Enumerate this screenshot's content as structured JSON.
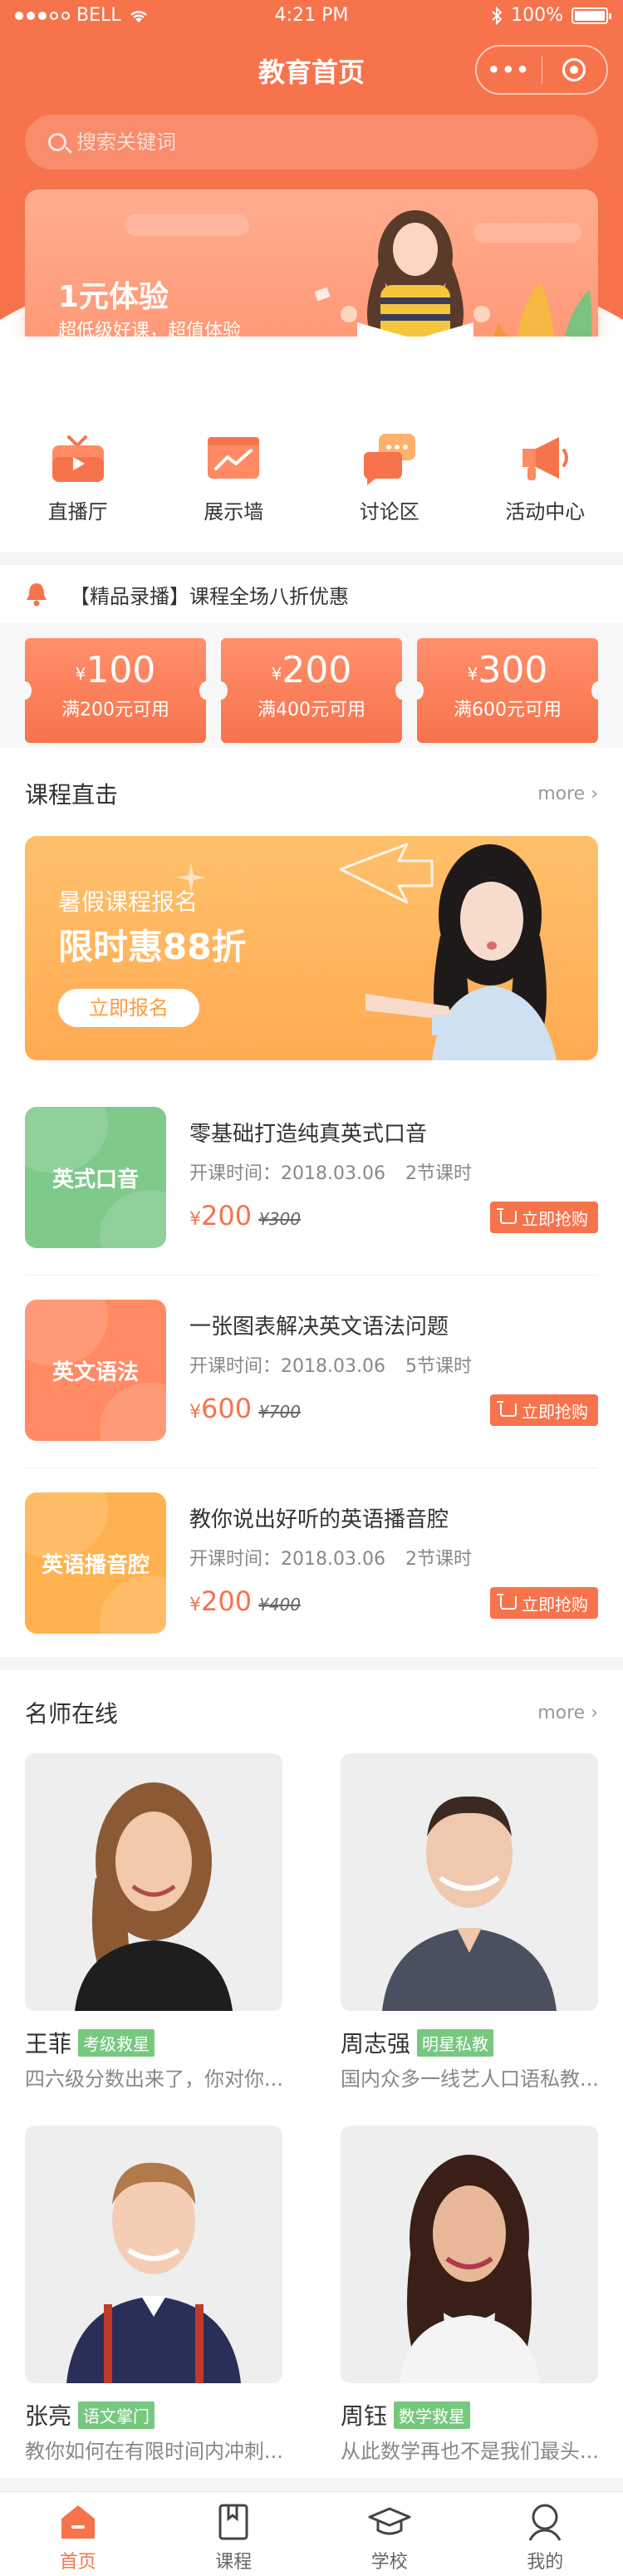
{
  "statusbar": {
    "carrier": "BELL",
    "time": "4:21 PM",
    "battery": "100%"
  },
  "navbar": {
    "title": "教育首页",
    "more_glyph": "•••"
  },
  "search": {
    "placeholder": "搜索关键词"
  },
  "banner": {
    "title": "1元体验",
    "subtitle": "超低级好课，超值体验"
  },
  "categories": [
    {
      "label": "直播厅",
      "icon": "tv-icon"
    },
    {
      "label": "展示墙",
      "icon": "chart-board-icon"
    },
    {
      "label": "讨论区",
      "icon": "chat-icon"
    },
    {
      "label": "活动中心",
      "icon": "megaphone-icon"
    }
  ],
  "notice": {
    "text": "【精品录播】课程全场八折优惠"
  },
  "coupons": [
    {
      "currency": "¥",
      "amount": "100",
      "condition": "满200元可用"
    },
    {
      "currency": "¥",
      "amount": "200",
      "condition": "满400元可用"
    },
    {
      "currency": "¥",
      "amount": "300",
      "condition": "满600元可用"
    }
  ],
  "courses_section": {
    "title": "课程直击",
    "more": "more ›"
  },
  "promo": {
    "line1": "暑假课程报名",
    "line2": "限时惠88折",
    "button": "立即报名"
  },
  "courses": [
    {
      "thumb_label": "英式口音",
      "thumb_color": "#7fc98a",
      "title": "零基础打造纯真英式口音",
      "start_label": "开课时间：",
      "start_date": "2018.03.06",
      "lessons": "2节课时",
      "currency": "¥",
      "price": "200",
      "original_price": "¥300",
      "buy_label": "立即抢购"
    },
    {
      "thumb_label": "英文语法",
      "thumb_color": "#ff8a63",
      "title": "一张图表解决英文语法问题",
      "start_label": "开课时间：",
      "start_date": "2018.03.06",
      "lessons": "5节课时",
      "currency": "¥",
      "price": "600",
      "original_price": "¥700",
      "buy_label": "立即抢购"
    },
    {
      "thumb_label": "英语播音腔",
      "thumb_color": "#ffb14f",
      "title": "教你说出好听的英语播音腔",
      "start_label": "开课时间：",
      "start_date": "2018.03.06",
      "lessons": "2节课时",
      "currency": "¥",
      "price": "200",
      "original_price": "¥400",
      "buy_label": "立即抢购"
    }
  ],
  "teachers_section": {
    "title": "名师在线",
    "more": "more ›"
  },
  "teachers": [
    {
      "name": "王菲",
      "tag": "考级救星",
      "desc": "四六级分数出来了，你对你..."
    },
    {
      "name": "周志强",
      "tag": "明星私教",
      "desc": "国内众多一线艺人口语私教..."
    },
    {
      "name": "张亮",
      "tag": "语文掌门",
      "desc": "教你如何在有限时间内冲刺..."
    },
    {
      "name": "周钰",
      "tag": "数学救星",
      "desc": "从此数学再也不是我们最头..."
    }
  ],
  "tabbar": [
    {
      "label": "首页",
      "icon": "home-icon",
      "active": true
    },
    {
      "label": "课程",
      "icon": "book-icon",
      "active": false
    },
    {
      "label": "学校",
      "icon": "graduation-cap-icon",
      "active": false
    },
    {
      "label": "我的",
      "icon": "user-icon",
      "active": false
    }
  ],
  "colors": {
    "accent": "#f7734c",
    "tag_green": "#77c87f",
    "promo_orange": "#ffab52"
  }
}
